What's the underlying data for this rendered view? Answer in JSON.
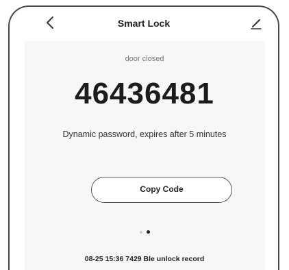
{
  "header": {
    "title": "Smart Lock",
    "back_icon": "chevron-left-icon",
    "edit_icon": "pencil-icon"
  },
  "lock": {
    "status": "door closed",
    "code": "46436481",
    "description": "Dynamic password, expires after 5 minutes",
    "copy_label": "Copy Code"
  },
  "pager": {
    "total": 2,
    "active_index": 1
  },
  "record": {
    "text": "08-25 15:36 7429 Ble unlock record"
  },
  "colors": {
    "card_background": "#f7f7f8",
    "text_primary": "#1c1c1c",
    "text_secondary": "#777777"
  }
}
